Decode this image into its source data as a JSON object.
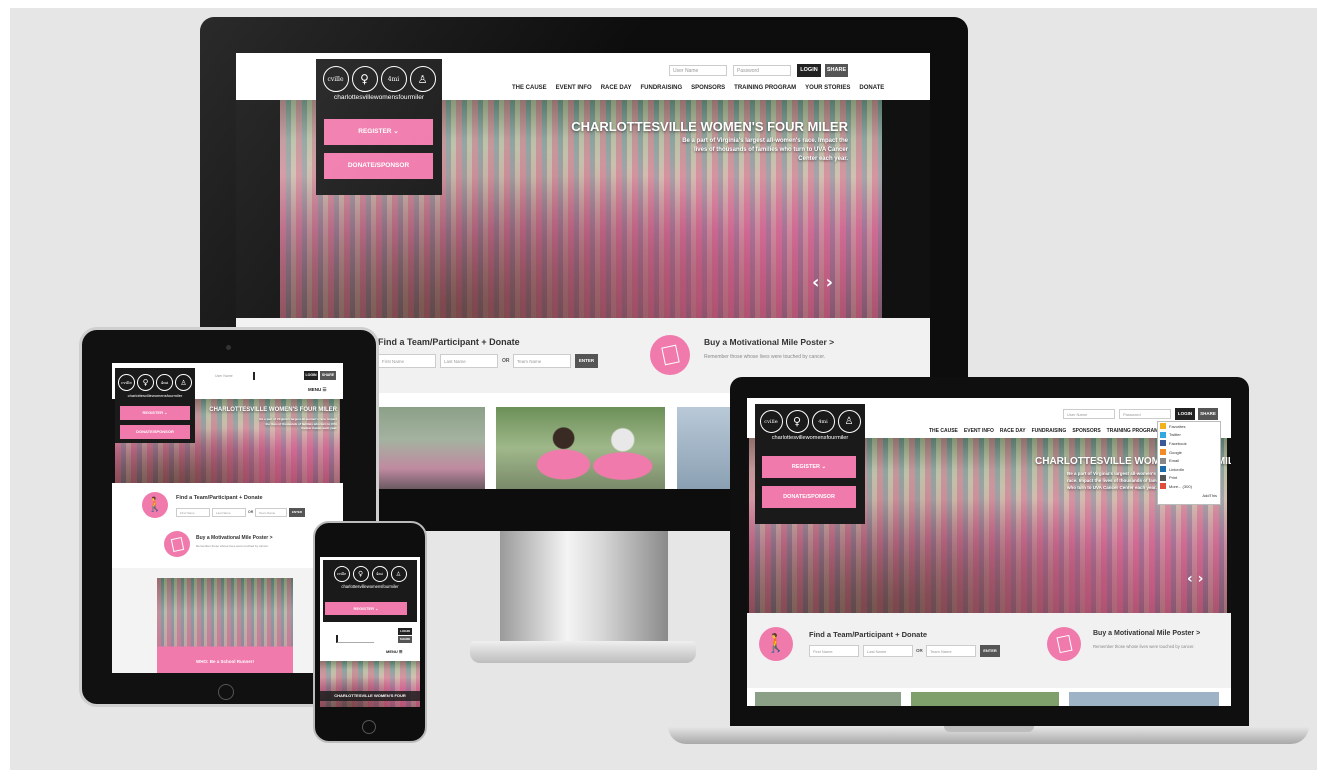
{
  "site": {
    "logo_text": "charlottesvillewomensfourmiler",
    "logo_marks": [
      "cville",
      "♀",
      "4mi",
      "♙"
    ],
    "nav_items": [
      "THE CAUSE",
      "EVENT INFO",
      "RACE DAY",
      "FUNDRAISING",
      "SPONSORS",
      "TRAINING PROGRAM",
      "YOUR STORIES",
      "DONATE"
    ],
    "login_placeholder_user": "User Name",
    "login_placeholder_pass": "Password",
    "login_label": "LOGIN",
    "share_label": "SHARE",
    "register_label": "REGISTER",
    "donate_sponsor_label": "DONATE/SPONSOR",
    "hero_title": "CHARLOTTESVILLE WOMEN'S FOUR MILER",
    "hero_subtitle": "Be a part of Virginia's largest all-women's race. Impact the lives of thousands of families who turn to UVA Cancer Center each year.",
    "find_title": "Find a Team/Participant + Donate",
    "first_name_placeholder": "First Name",
    "last_name_placeholder": "Last Name",
    "or_label": "OR",
    "team_name_placeholder": "Team Name",
    "enter_label": "ENTER",
    "poster_title": "Buy a Motivational Mile Poster >",
    "poster_sub": "Remember those whose lives were touched by cancer.",
    "menu_label": "MENU",
    "mobile_title": "CHARLOTTESVILLE WOMEN'S FOUR",
    "tablet_caption": "WHO: Be a School Runner!",
    "share_menu": [
      "Favorites",
      "Twitter",
      "Facebook",
      "Google",
      "Email",
      "LinkedIn",
      "Print",
      "More... (300)"
    ],
    "share_menu_colors": [
      "#f2b21a",
      "#33a8e0",
      "#3b5998",
      "#f28c24",
      "#888888",
      "#1b6ca8",
      "#555555",
      "#e04b3a"
    ],
    "addthis_label": "AddThis"
  }
}
